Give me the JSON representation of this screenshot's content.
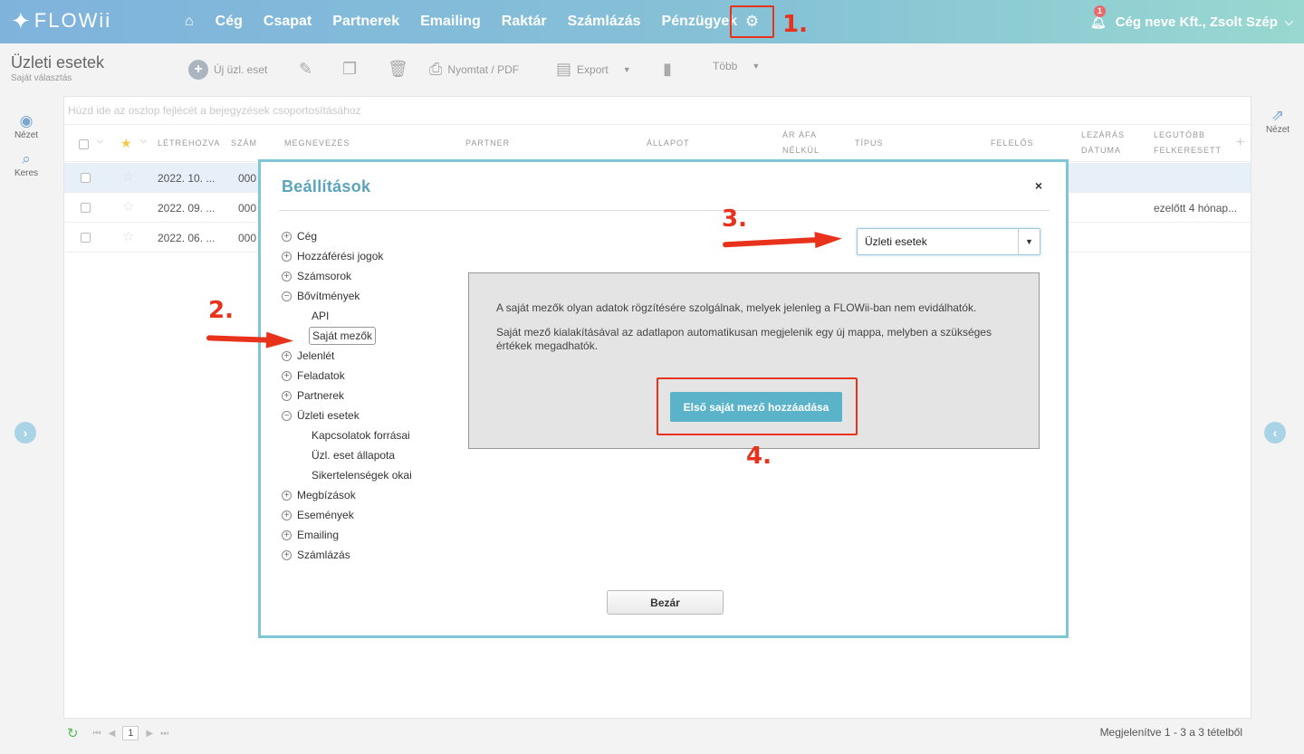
{
  "app": {
    "logo": "FLOWii",
    "user": "Cég neve Kft., Zsolt Szép",
    "notif_count": "1"
  },
  "nav": {
    "items": [
      "Cég",
      "Csapat",
      "Partnerek",
      "Emailing",
      "Raktár",
      "Számlázás",
      "Pénzügyek"
    ]
  },
  "annotations": {
    "a1": "1.",
    "a2": "2.",
    "a3": "3.",
    "a4": "4."
  },
  "page": {
    "title": "Üzleti esetek",
    "subtitle": "Saját választás"
  },
  "toolbar": {
    "new": "Új üzl. eset",
    "print": "Nyomtat / PDF",
    "export": "Export",
    "more": "Több"
  },
  "rail": {
    "view": "Nézet",
    "search": "Keres",
    "view_right": "Nézet"
  },
  "grid": {
    "group_hint": "Húzd ide az oszlop fejlécét a bejegyzések csoportosításához",
    "headers": {
      "created": "Létrehozva",
      "num": "Szám",
      "name": "Megnevezés",
      "partner": "Partner",
      "status": "Állapot",
      "price_1": "Ár áfa",
      "price_2": "nélkül",
      "type": "Típus",
      "owner": "Felelős",
      "close_1": "Lezárás",
      "close_2": "dátuma",
      "last_1": "Legutóbb",
      "last_2": "felkeresett"
    },
    "rows": [
      {
        "created": "2022. 10. ...",
        "num": "000",
        "last": ""
      },
      {
        "created": "2022. 09. ...",
        "num": "000",
        "last": "ezelőtt  4 hónap..."
      },
      {
        "created": "2022. 06. ...",
        "num": "000",
        "last": ""
      }
    ]
  },
  "footer": {
    "page": "1",
    "showing": "Megjelenítve 1 - 3 a 3 tételből"
  },
  "modal": {
    "title": "Beállítások",
    "close_x": "×",
    "tree": [
      {
        "label": "Cég",
        "level": 0,
        "sign": "+"
      },
      {
        "label": "Hozzáférési jogok",
        "level": 0,
        "sign": "+"
      },
      {
        "label": "Számsorok",
        "level": 0,
        "sign": "+"
      },
      {
        "label": "Bővítmények",
        "level": 0,
        "sign": "−"
      },
      {
        "label": "API",
        "level": 1
      },
      {
        "label": "Saját mezők",
        "level": 1,
        "highlight": true
      },
      {
        "label": "Jelenlét",
        "level": 0,
        "sign": "+"
      },
      {
        "label": "Feladatok",
        "level": 0,
        "sign": "+"
      },
      {
        "label": "Partnerek",
        "level": 0,
        "sign": "+"
      },
      {
        "label": "Üzleti esetek",
        "level": 0,
        "sign": "−"
      },
      {
        "label": "Kapcsolatok forrásai",
        "level": 1
      },
      {
        "label": "Üzl. eset állapota",
        "level": 1
      },
      {
        "label": "Sikertelenségek okai",
        "level": 1
      },
      {
        "label": "Megbízások",
        "level": 0,
        "sign": "+"
      },
      {
        "label": "Események",
        "level": 0,
        "sign": "+"
      },
      {
        "label": "Emailing",
        "level": 0,
        "sign": "+"
      },
      {
        "label": "Számlázás",
        "level": 0,
        "sign": "+"
      }
    ],
    "select_value": "Üzleti esetek",
    "info_1": "A saját mezők olyan adatok rögzítésére szolgálnak, melyek jelenleg a FLOWii-ban nem evidálhatók.",
    "info_2": "Saját mező kialakításával az adatlapon automatikusan megjelenik egy új mappa, melyben a szükséges értékek megadhatók.",
    "add_button": "Első saját mező hozzáadása",
    "close_button": "Bezár"
  },
  "colors": {
    "accent": "#5ab3c9",
    "annotation": "#e8321b"
  }
}
